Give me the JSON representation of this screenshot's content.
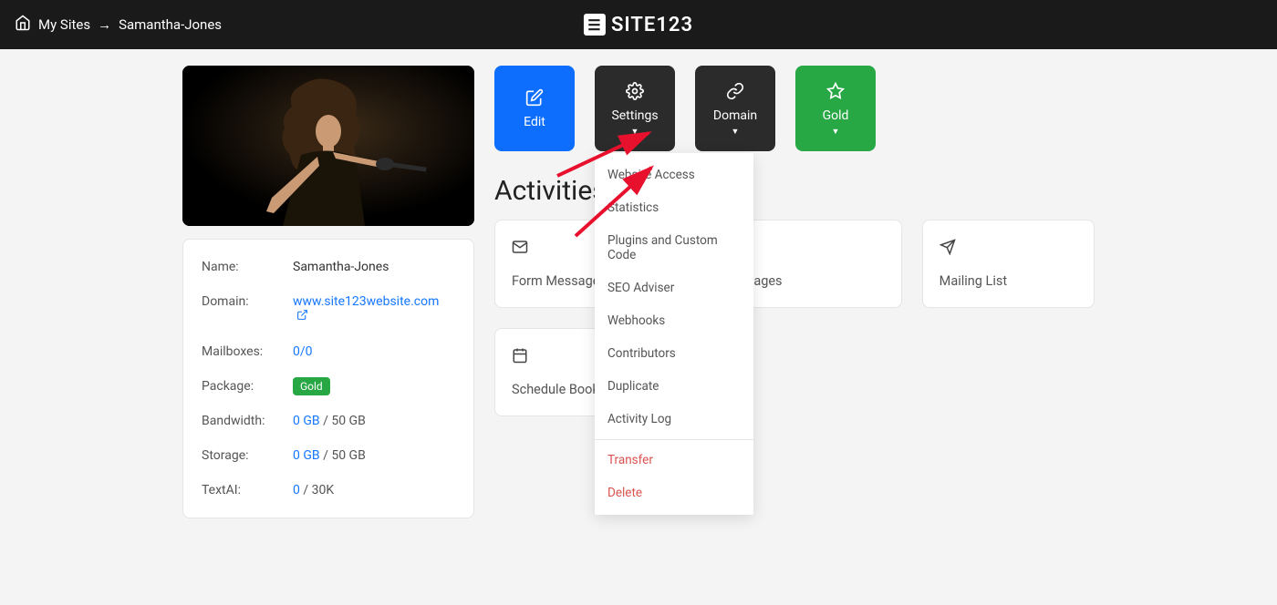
{
  "topbar": {
    "breadcrumb_home": "My Sites",
    "breadcrumb_current": "Samantha-Jones",
    "logo_text": "SITE123"
  },
  "actions": {
    "edit": "Edit",
    "settings": "Settings",
    "domain": "Domain",
    "gold": "Gold"
  },
  "dropdown": {
    "items": [
      "Website Access",
      "Statistics",
      "Plugins and Custom Code",
      "SEO Adviser",
      "Webhooks",
      "Contributors",
      "Duplicate",
      "Activity Log"
    ],
    "danger_items": [
      "Transfer",
      "Delete"
    ]
  },
  "info": {
    "name_label": "Name:",
    "name_value": "Samantha-Jones",
    "domain_label": "Domain:",
    "domain_value": "www.site123website.com",
    "mailboxes_label": "Mailboxes:",
    "mailboxes_value": "0/0",
    "package_label": "Package:",
    "package_value": "Gold",
    "bandwidth_label": "Bandwidth:",
    "bandwidth_used": "0 GB",
    "bandwidth_total": " / 50 GB",
    "storage_label": "Storage:",
    "storage_used": "0 GB",
    "storage_total": " / 50 GB",
    "textai_label": "TextAI:",
    "textai_used": "0",
    "textai_total": " / 30K"
  },
  "activities": {
    "title": "Activities",
    "form_messages": "Form Messages",
    "languages": "uages",
    "mailing_list": "Mailing List",
    "schedule_booking": "Schedule Booki"
  }
}
